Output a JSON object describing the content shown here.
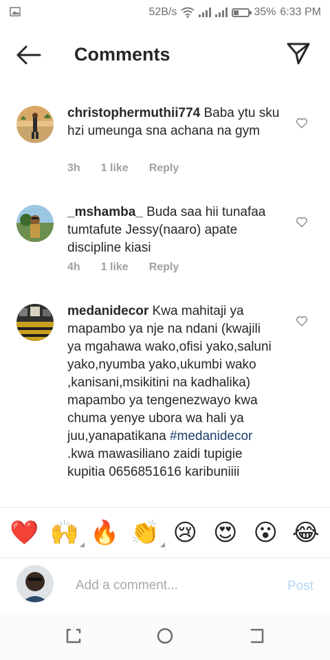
{
  "status_bar": {
    "net_speed": "52B/s",
    "battery": "35%",
    "battery_level": 0.35,
    "time": "6:33 PM"
  },
  "header": {
    "title": "Comments",
    "back_icon": "arrow-left-icon",
    "send_icon": "direct-send-icon"
  },
  "comments": [
    {
      "username": "christophermuthii774",
      "text": "Baba ytu sku hzi umeunga sna achana na gym",
      "time": "3h",
      "likes": "1 like",
      "reply": "Reply"
    },
    {
      "username": "_mshamba_",
      "text": "Buda saa hii tunafaa tumtafute Jessy(naaro) apate discipline kiasi",
      "time": "4h",
      "likes": "1 like",
      "reply": "Reply"
    },
    {
      "username": "medanidecor",
      "text_before": "Kwa mahitaji ya mapambo ya nje na ndani (kwajili ya mgahawa wako,ofisi yako,saluni yako,nyumba yako,ukumbi wako ,kanisani,msikitini na kadhalika) mapambo ya tengenezwayo kwa chuma yenye ubora wa hali ya juu,yanapatikana ",
      "hashtag": "#medanidecor",
      "text_after": " .kwa mawasiliano zaidi tupigie kupitia 0656851616 karibuniiii"
    }
  ],
  "emoji_bar": [
    "❤️",
    "🙌",
    "🔥",
    "👏",
    "😢",
    "😍",
    "😮",
    "😂"
  ],
  "composer": {
    "placeholder": "Add a comment...",
    "post_label": "Post"
  },
  "colors": {
    "text": "#262626",
    "meta": "#a0a0a0",
    "hashtag": "#1b3e6c",
    "post_disabled": "#b3d8f7"
  }
}
